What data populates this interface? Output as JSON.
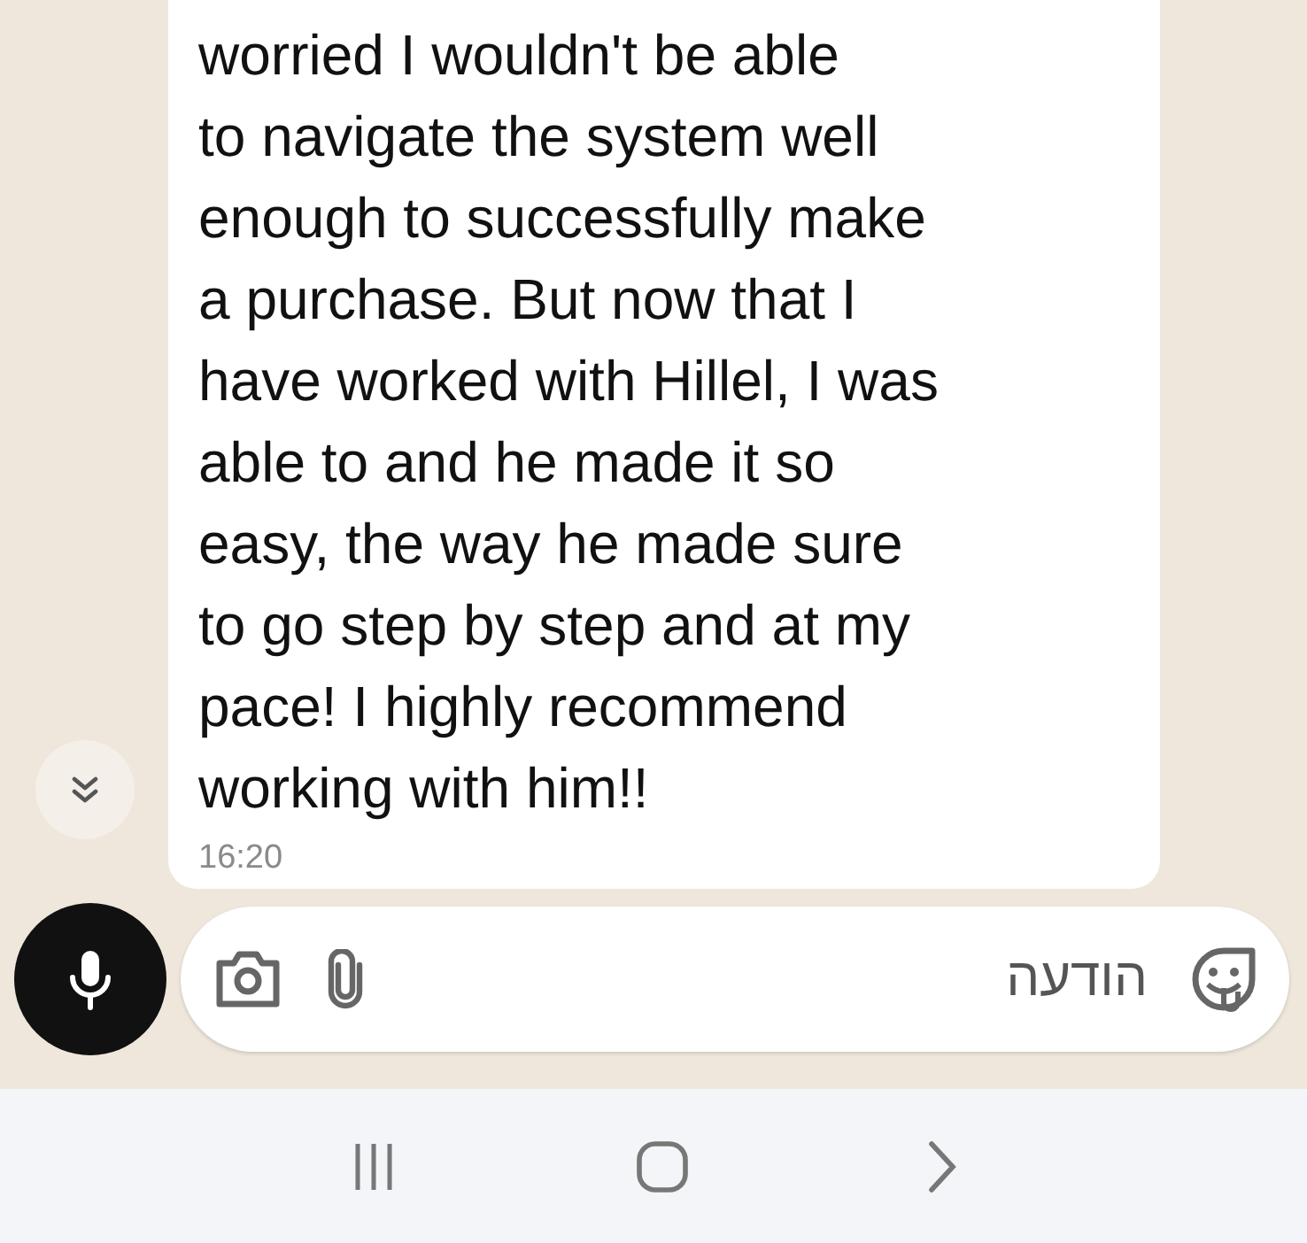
{
  "message": {
    "lines": [
      "worried I wouldn't be able",
      "to navigate the system well",
      "enough to successfully make",
      "a purchase. But now that I",
      "have worked with Hillel, I was",
      "able to and he made it so",
      "easy, the way he made sure",
      "to go step by step and at my",
      "pace! I highly recommend",
      "working with him!!"
    ],
    "time": "16:20"
  },
  "composer": {
    "placeholder": "הודעה"
  }
}
